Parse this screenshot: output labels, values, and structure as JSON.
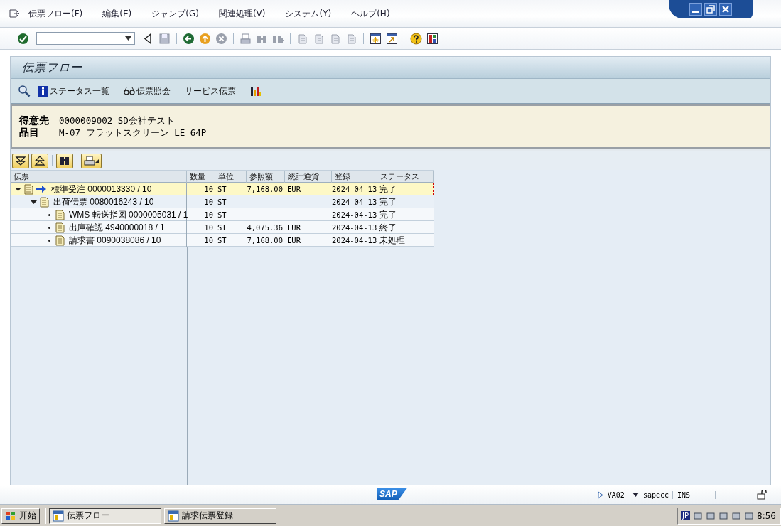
{
  "menu_bar": {
    "items": [
      "伝票フロー(F)",
      "編集(E)",
      "ジャンプ(G)",
      "関連処理(V)",
      "システム(Y)",
      "ヘルプ(H)"
    ]
  },
  "screen_title": "伝票フロー",
  "app_toolbar": {
    "buttons": [
      {
        "label": "ステータス一覧",
        "kind": "info"
      },
      {
        "label": "伝票照会",
        "kind": "glasses"
      },
      {
        "label": "サービス伝票",
        "kind": "text"
      }
    ]
  },
  "header": {
    "fields": [
      {
        "label": "得意先",
        "value": "0000009002 SD会社テスト"
      },
      {
        "label": "品目",
        "value": "M-07 フラットスクリーン LE 64P"
      }
    ]
  },
  "tree": {
    "columns": [
      "伝票",
      "数量",
      "単位",
      "参照額",
      "統計通貨",
      "登録",
      "ステータス"
    ],
    "rows": [
      {
        "document": "標準受注 0000013330 / 10",
        "quantity": "10",
        "unit": "ST",
        "amount": "7,168.00",
        "currency": "EUR",
        "date": "2024-04-13",
        "status": "完了",
        "selected": true,
        "current": true,
        "expanded": true,
        "children": [
          {
            "document": "出荷伝票 0080016243 / 10",
            "quantity": "10",
            "unit": "ST",
            "date": "2024-04-13",
            "status": "完了",
            "selected": false,
            "current": false,
            "expanded": true,
            "children": [
              {
                "document": "WMS 転送指図 0000005031 / 1",
                "quantity": "10",
                "unit": "ST",
                "date": "2024-04-13",
                "status": "完了",
                "selected": false,
                "current": false
              },
              {
                "document": "出庫確認 4940000018 / 1",
                "quantity": "10",
                "unit": "ST",
                "amount": "4,075.36",
                "currency": "EUR",
                "date": "2024-04-13",
                "status": "終了",
                "selected": false,
                "current": false
              },
              {
                "document": "請求書 0090038086 / 10",
                "quantity": "10",
                "unit": "ST",
                "amount": "7,168.00",
                "currency": "EUR",
                "date": "2024-04-13",
                "status": "未処理",
                "selected": false,
                "current": false
              }
            ]
          }
        ]
      }
    ]
  },
  "status_bar": {
    "logo": "SAP",
    "transaction": "VA02",
    "system": "sapecc",
    "mode": "INS"
  },
  "taskbar": {
    "start": "开始",
    "tasks": [
      {
        "label": "伝票フロー",
        "selected": true
      },
      {
        "label": "請求伝票登録",
        "selected": false
      }
    ],
    "language": "JP",
    "clock": "8:56"
  }
}
